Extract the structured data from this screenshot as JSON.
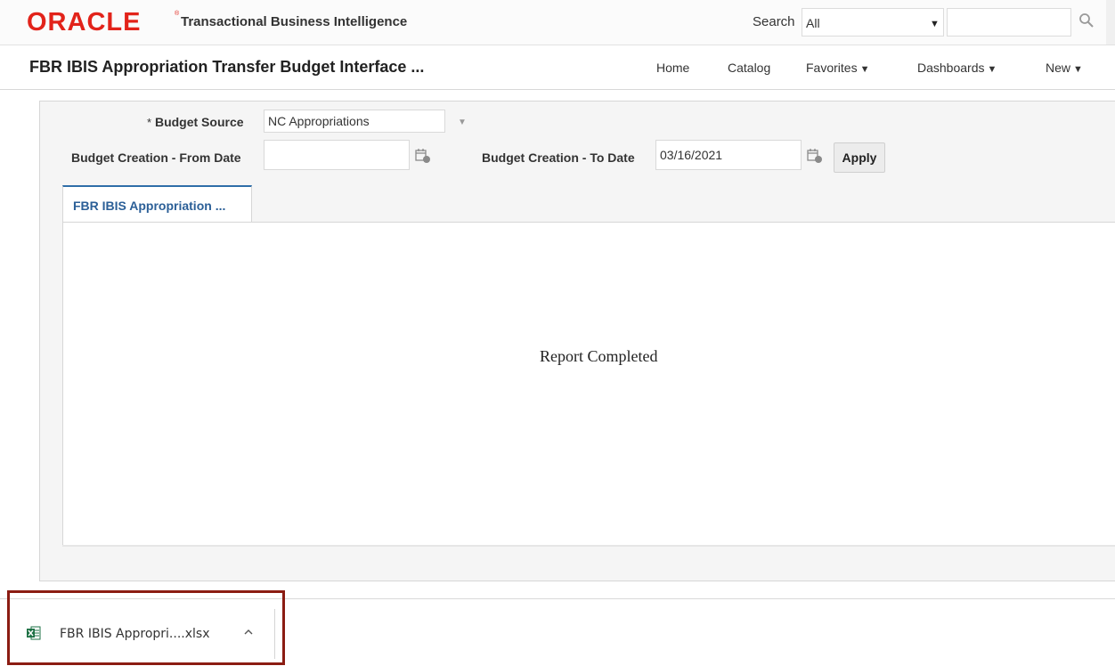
{
  "header": {
    "logo_text": "ORACLE",
    "logo_mark": "®",
    "product_name": "Transactional Business Intelligence",
    "search_label": "Search",
    "search_scope": "All",
    "search_value": "",
    "brand_color": "#e2231a"
  },
  "titlebar": {
    "page_title": "FBR IBIS Appropriation Transfer Budget Interface ...",
    "nav": [
      {
        "label": "Home",
        "has_menu": false
      },
      {
        "label": "Catalog",
        "has_menu": false
      },
      {
        "label": "Favorites",
        "has_menu": true
      },
      {
        "label": "Dashboards",
        "has_menu": true
      },
      {
        "label": "New",
        "has_menu": true
      }
    ]
  },
  "prompts": {
    "budget_source": {
      "required_mark": "*",
      "label": "Budget Source",
      "value": "NC Appropriations"
    },
    "from_date": {
      "label": "Budget Creation - From Date",
      "value": ""
    },
    "to_date": {
      "label": "Budget Creation - To Date",
      "value": "03/16/2021"
    },
    "apply_label": "Apply"
  },
  "tabs": [
    {
      "label": "FBR IBIS Appropriation ...",
      "active": true
    }
  ],
  "content": {
    "message": "Report Completed"
  },
  "download_bar": {
    "file_name": "FBR IBIS Appropri....xlsx",
    "file_icon": "excel-file-icon",
    "highlight_color": "#8b1c12"
  }
}
